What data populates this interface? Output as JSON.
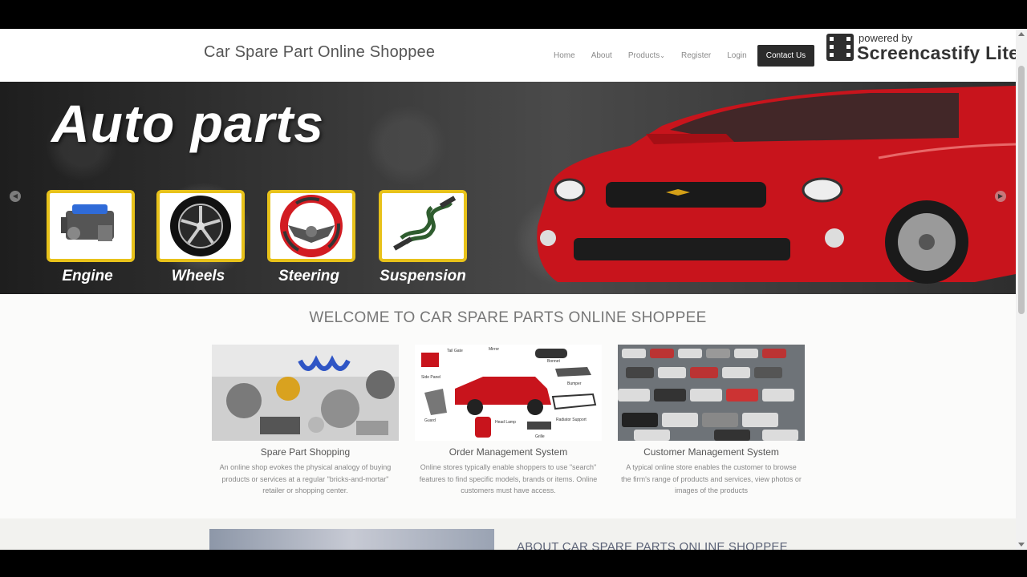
{
  "site": {
    "brand": "Car Spare Part Online Shoppee"
  },
  "nav": {
    "items": [
      {
        "label": "Home"
      },
      {
        "label": "About"
      },
      {
        "label": "Products"
      },
      {
        "label": "Register"
      },
      {
        "label": "Login"
      }
    ],
    "contact_label": "Contact Us",
    "products_caret": "⌄"
  },
  "watermark": {
    "top": "powered by",
    "main": "Screencastify Lite"
  },
  "banner": {
    "title": "Auto parts",
    "tiles": [
      {
        "label": "Engine"
      },
      {
        "label": "Wheels"
      },
      {
        "label": "Steering"
      },
      {
        "label": "Suspension"
      }
    ],
    "prev_glyph": "◀",
    "next_glyph": "▶"
  },
  "welcome": {
    "heading": "WELCOME TO CAR SPARE PARTS ONLINE SHOPPEE"
  },
  "features": [
    {
      "title": "Spare Part Shopping",
      "text": "An online shop evokes the physical analogy of buying products or services at a regular \"bricks-and-mortar\" retailer or shopping center."
    },
    {
      "title": "Order Management System",
      "text": "Online stores typically enable shoppers to use \"search\" features to find specific models, brands or items. Online customers must have access."
    },
    {
      "title": "Customer Management System",
      "text": "A typical online store enables the customer to browse the firm's range of products and services, view photos or images of the products"
    }
  ],
  "parts_labels": [
    "Tail Gate",
    "Mirror",
    "Bonnet",
    "Side Panel",
    "Bumper",
    "Guard",
    "Head Lamp",
    "Grille",
    "Radiator Support"
  ],
  "about": {
    "heading": "ABOUT CAR SPARE PARTS ONLINE SHOPPEE"
  },
  "colors": {
    "accent_dark": "#2b2b2b",
    "tile_border": "#e8c21a",
    "car_red": "#c8141c"
  }
}
